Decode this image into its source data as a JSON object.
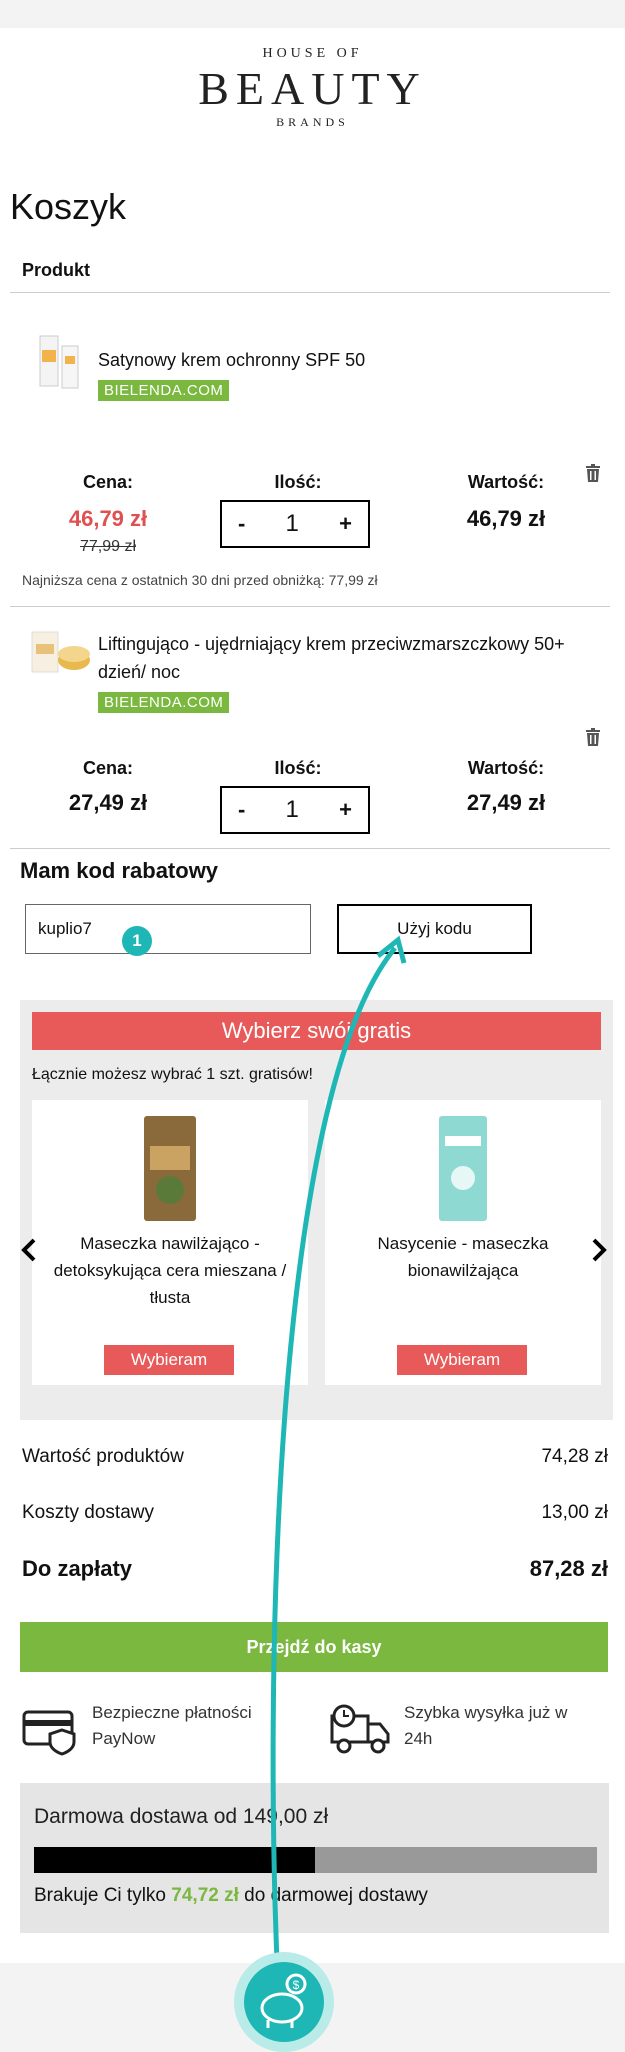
{
  "brand": {
    "line1": "HOUSE OF",
    "line2": "BEAUTY",
    "line3": "BRANDS"
  },
  "page_title": "Koszyk",
  "column_header": "Produkt",
  "labels": {
    "price": "Cena:",
    "qty": "Ilość:",
    "value": "Wartość:"
  },
  "products": [
    {
      "name": "Satynowy krem ochronny SPF 50",
      "shop": "BIELENDA.COM",
      "price": "46,79 zł",
      "old_price": "77,99 zł",
      "quantity": "1",
      "total": "46,79 zł",
      "lowest_price_note": "Najniższa cena z ostatnich 30 dni przed obniżką: 77,99 zł"
    },
    {
      "name": "Liftingująco - ujędrniający krem przeciwzmarszczkowy 50+ dzień/ noc",
      "shop": "BIELENDA.COM",
      "price": "27,49 zł",
      "quantity": "1",
      "total": "27,49 zł"
    }
  ],
  "qty_minus": "-",
  "qty_plus": "+",
  "discount": {
    "title": "Mam kod rabatowy",
    "code_value": "kuplio7",
    "apply_label": "Użyj kodu",
    "step_badge": "1"
  },
  "gifts": {
    "banner": "Wybierz swój gratis",
    "note": "Łącznie możesz wybrać 1 szt. gratisów!",
    "items": [
      {
        "name": "Maseczka nawilżająco - detoksykująca cera mieszana / tłusta",
        "pick": "Wybieram"
      },
      {
        "name": "Nasycenie - maseczka bionawilżająca",
        "pick": "Wybieram"
      }
    ],
    "prev_arrow": "‹",
    "next_arrow": "›"
  },
  "summary": {
    "products_label": "Wartość produktów",
    "products_value": "74,28 zł",
    "shipping_label": "Koszty dostawy",
    "shipping_value": "13,00 zł",
    "total_label": "Do zapłaty",
    "total_value": "87,28 zł"
  },
  "checkout_label": "Przejdź do kasy",
  "features": {
    "payment": "Bezpieczne płatności PayNow",
    "delivery": "Szybka wysyłka już w 24h"
  },
  "free_shipping": {
    "title": "Darmowa dostawa od 149,00 zł",
    "progress_fraction": 0.4985,
    "msg_before": "Brakuje Ci tylko ",
    "amount": "74,72 zł",
    "msg_after": " do darmowej dostawy"
  },
  "colors": {
    "accent_red": "#e85a5a",
    "accent_green": "#7ab83f",
    "teal": "#1fb7b5"
  }
}
